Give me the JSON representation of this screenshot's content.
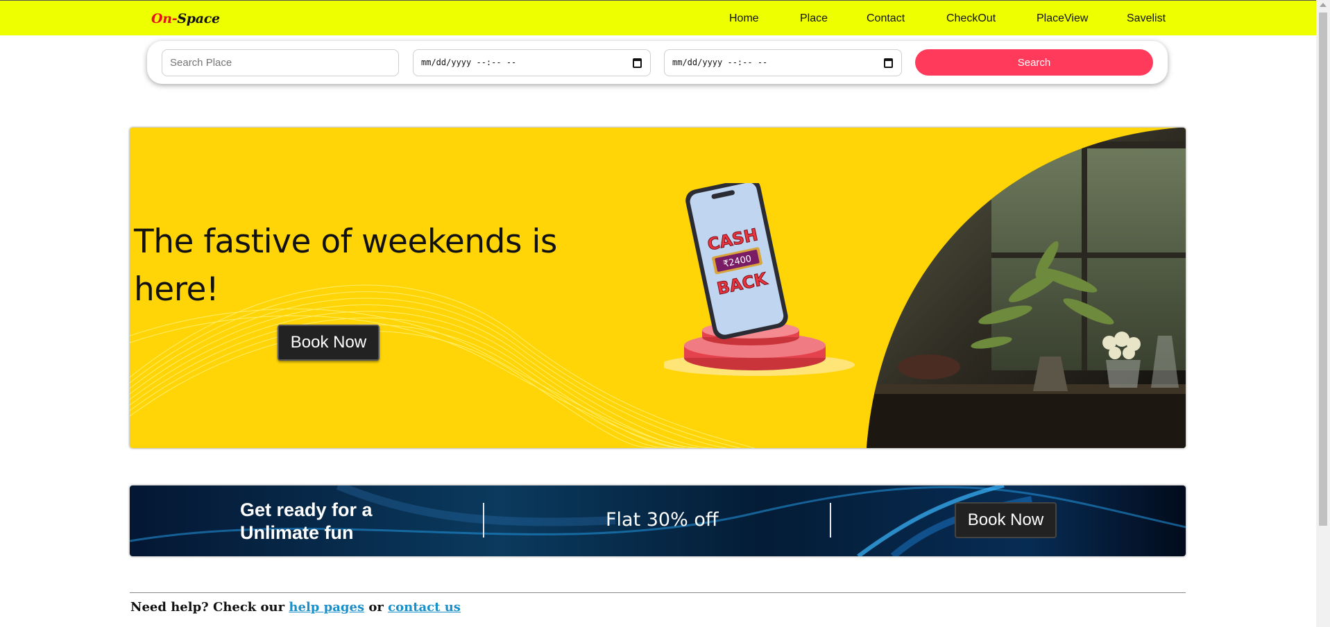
{
  "navbar": {
    "logo_on": "On-",
    "logo_space": "Space",
    "links": [
      {
        "label": "Home"
      },
      {
        "label": "Place"
      },
      {
        "label": "Contact"
      },
      {
        "label": "CheckOut"
      },
      {
        "label": "PlaceView"
      },
      {
        "label": "Savelist"
      }
    ],
    "background_color": "#eeff00"
  },
  "search": {
    "place_placeholder": "Search Place",
    "place_value": "",
    "checkin_placeholder": "mm/dd/yyyy --:-- --",
    "checkout_placeholder": "mm/dd/yyyy --:-- --",
    "button_label": "Search",
    "button_color": "#ff3a5a"
  },
  "hero": {
    "title": "The fastive of weekends is here!",
    "button_label": "Book Now",
    "phone_text_top": "CASH",
    "phone_amount": "₹2400",
    "phone_text_bottom": "BACK",
    "background_color": "#ffd508"
  },
  "promo": {
    "headline": "Get ready for a Unlimate fun",
    "offer": "Flat 30% off",
    "button_label": "Book Now"
  },
  "footer": {
    "prefix": "Need help? Check our",
    "help_link": "help pages",
    "middle": "or",
    "contact_link": "contact us"
  }
}
